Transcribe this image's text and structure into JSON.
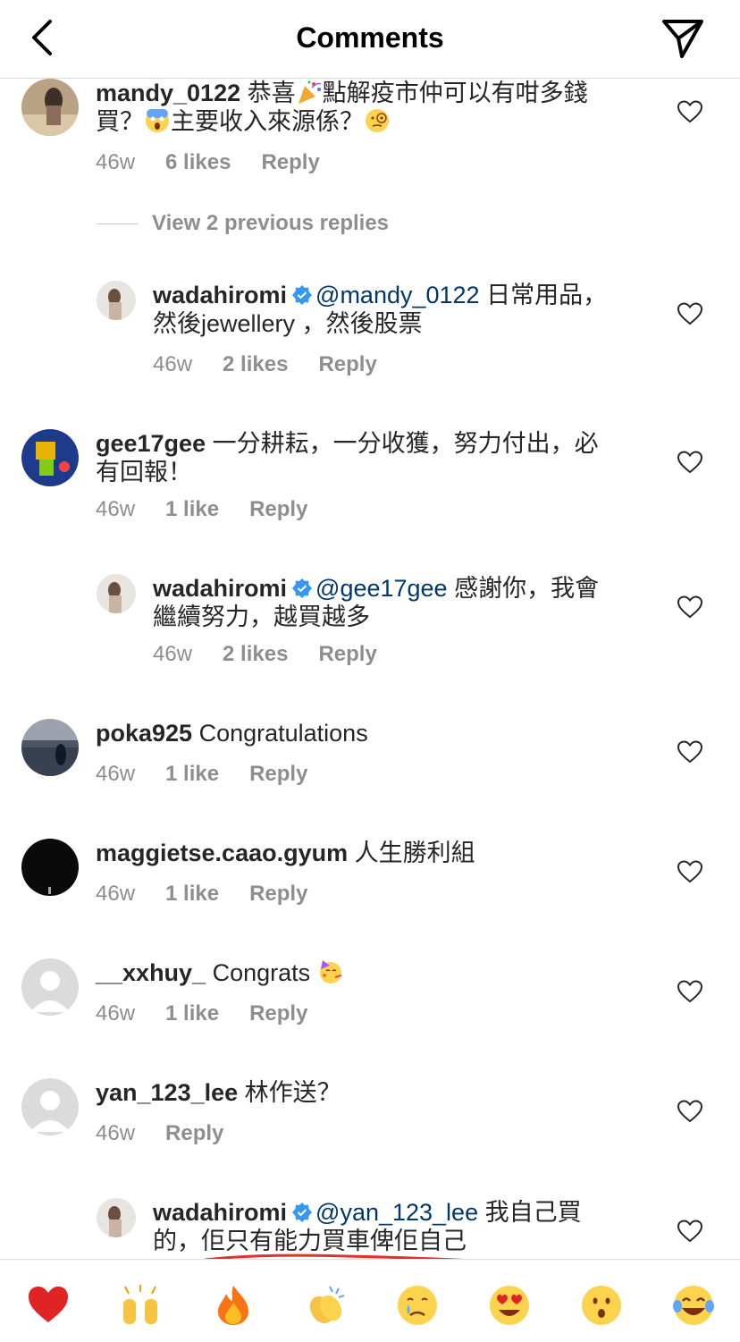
{
  "header": {
    "title": "Comments"
  },
  "view_replies": "View 2 previous replies",
  "comments": [
    {
      "user": "mandy_0122",
      "text": " 恭喜",
      "text_line1_end": "點解疫市仲可以有咁多錢",
      "text_line2_start": "買？",
      "text_line2_mid": "主要收入來源係？",
      "time": "46w",
      "likes": "6 likes",
      "reply": "Reply"
    },
    {
      "user": "wadahiromi",
      "mention": "@mandy_0122",
      "text": " 日常用品，",
      "text2": "然後jewellery ，然後股票",
      "time": "46w",
      "likes": "2 likes",
      "reply": "Reply"
    },
    {
      "user": "gee17gee",
      "text": " 一分耕耘，一分收獲，努力付出，必",
      "text2": "有回報！",
      "time": "46w",
      "likes": "1 like",
      "reply": "Reply"
    },
    {
      "user": "wadahiromi",
      "mention": "@gee17gee",
      "text": " 感謝你，我會",
      "text2": "繼續努力，越買越多",
      "time": "46w",
      "likes": "2 likes",
      "reply": "Reply"
    },
    {
      "user": "poka925",
      "text": " Congratulations",
      "time": "46w",
      "likes": "1 like",
      "reply": "Reply"
    },
    {
      "user": "maggietse.caao.gyum",
      "text": " 人生勝利組",
      "time": "46w",
      "likes": "1 like",
      "reply": "Reply"
    },
    {
      "user": "__xxhuy_",
      "text": " Congrats",
      "time": "46w",
      "likes": "1 like",
      "reply": "Reply"
    },
    {
      "user": "yan_123_lee",
      "text": " 林作送？",
      "time": "46w",
      "reply": "Reply"
    },
    {
      "user": "wadahiromi",
      "mention": "@yan_123_lee",
      "text": " 我自己買",
      "text2a": "的，",
      "text2b": "佢只有能力買車俾佢自己"
    }
  ],
  "icons": {
    "back": "chevron-left-icon",
    "send": "paper-plane-icon",
    "heart": "heart-outline-icon",
    "verified": "verified-badge-icon"
  },
  "emoji_bar": [
    "heart-emoji",
    "raised-hands-emoji",
    "fire-emoji",
    "clapping-emoji",
    "crying-emoji",
    "heart-eyes-emoji",
    "surprised-emoji",
    "tears-of-joy-emoji"
  ],
  "colors": {
    "mention": "#00376b",
    "meta": "#8e8e8e",
    "verified": "#3897f0",
    "underline": "#e0312b"
  }
}
